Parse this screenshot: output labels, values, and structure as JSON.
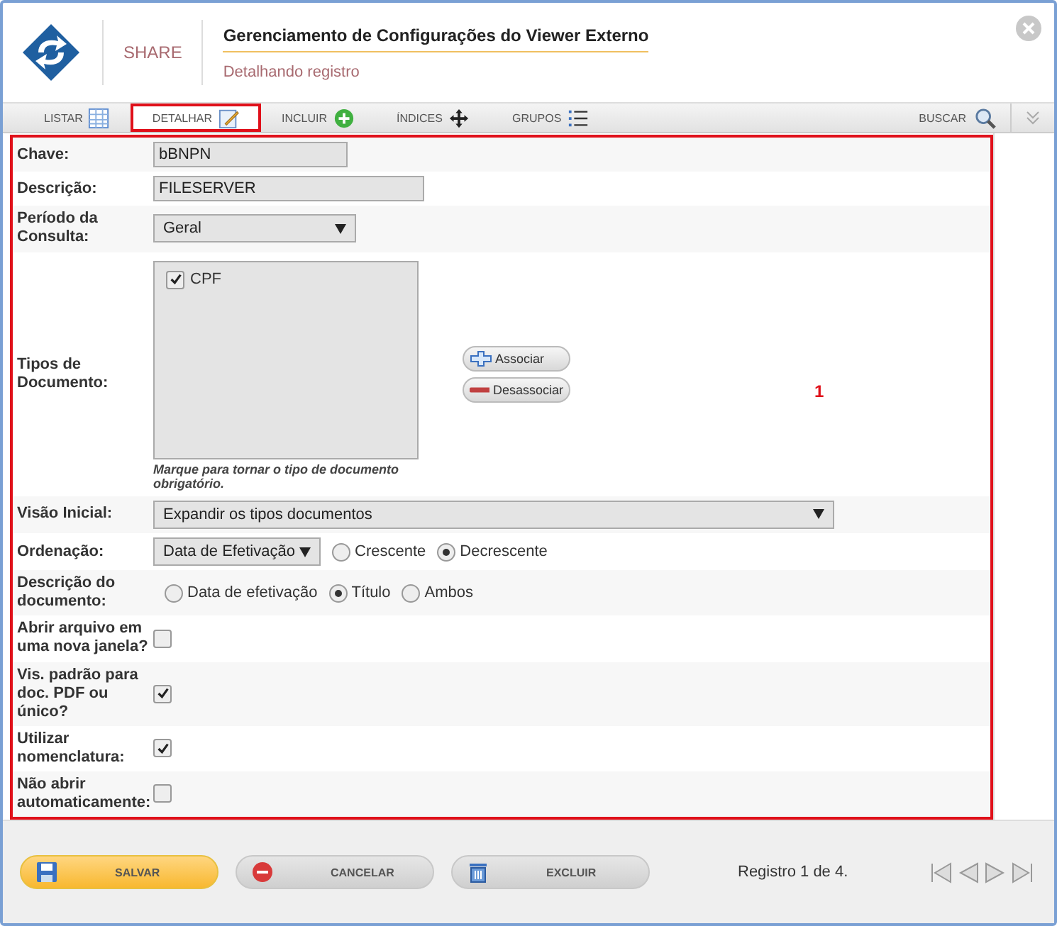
{
  "header": {
    "brand": "SHARE",
    "title": "Gerenciamento de Configurações do Viewer Externo",
    "subtitle": "Detalhando registro"
  },
  "tabs": [
    {
      "label": "LISTAR",
      "selected": false,
      "highlighted": false
    },
    {
      "label": "DETALHAR",
      "selected": true,
      "highlighted": true
    },
    {
      "label": "INCLUIR",
      "selected": false,
      "highlighted": false
    },
    {
      "label": "ÍNDICES",
      "selected": false,
      "highlighted": false
    },
    {
      "label": "GRUPOS",
      "selected": false,
      "highlighted": false
    }
  ],
  "search": {
    "label": "BUSCAR"
  },
  "form": {
    "highlighted": true,
    "callout": "1",
    "fields": [
      {
        "kind": "text",
        "label": "Chave:",
        "value": "bBNPN"
      },
      {
        "kind": "text",
        "label": "Descrição:",
        "value": "FILESERVER"
      },
      {
        "kind": "select",
        "label": "Período da Consulta:",
        "value": "Geral"
      },
      {
        "kind": "listbox",
        "label": "Tipos de Documento:",
        "items": [
          {
            "label": "CPF",
            "checked": true
          }
        ],
        "buttons": [
          {
            "label": "Associar"
          },
          {
            "label": "Desassociar"
          }
        ],
        "note": "Marque para tornar o tipo de documento obrigatório."
      },
      {
        "kind": "select",
        "label": "Visão Inicial:",
        "value": "Expandir os tipos documentos"
      },
      {
        "kind": "select_radios",
        "label": "Ordenação:",
        "value": "Data de Efetivação",
        "options": [
          {
            "label": "Crescente",
            "selected": false
          },
          {
            "label": "Decrescente",
            "selected": true
          }
        ]
      },
      {
        "kind": "radios",
        "label": "Descrição do documento:",
        "options": [
          {
            "label": "Data de efetivação",
            "selected": false
          },
          {
            "label": "Título",
            "selected": true
          },
          {
            "label": "Ambos",
            "selected": false
          }
        ]
      },
      {
        "kind": "checkbox",
        "label": "Abrir arquivo em uma nova janela?",
        "checked": false
      },
      {
        "kind": "checkbox",
        "label": "Vis. padrão para doc. PDF ou único?",
        "checked": true
      },
      {
        "kind": "checkbox",
        "label": "Utilizar nomenclatura:",
        "checked": true
      },
      {
        "kind": "checkbox",
        "label": "Não abrir automaticamente:",
        "checked": false
      }
    ]
  },
  "footer": {
    "buttons": [
      {
        "label": "SALVAR",
        "primary": true
      },
      {
        "label": "CANCELAR",
        "primary": false
      },
      {
        "label": "EXCLUIR",
        "primary": false
      }
    ],
    "status": "Registro 1 de 4."
  }
}
